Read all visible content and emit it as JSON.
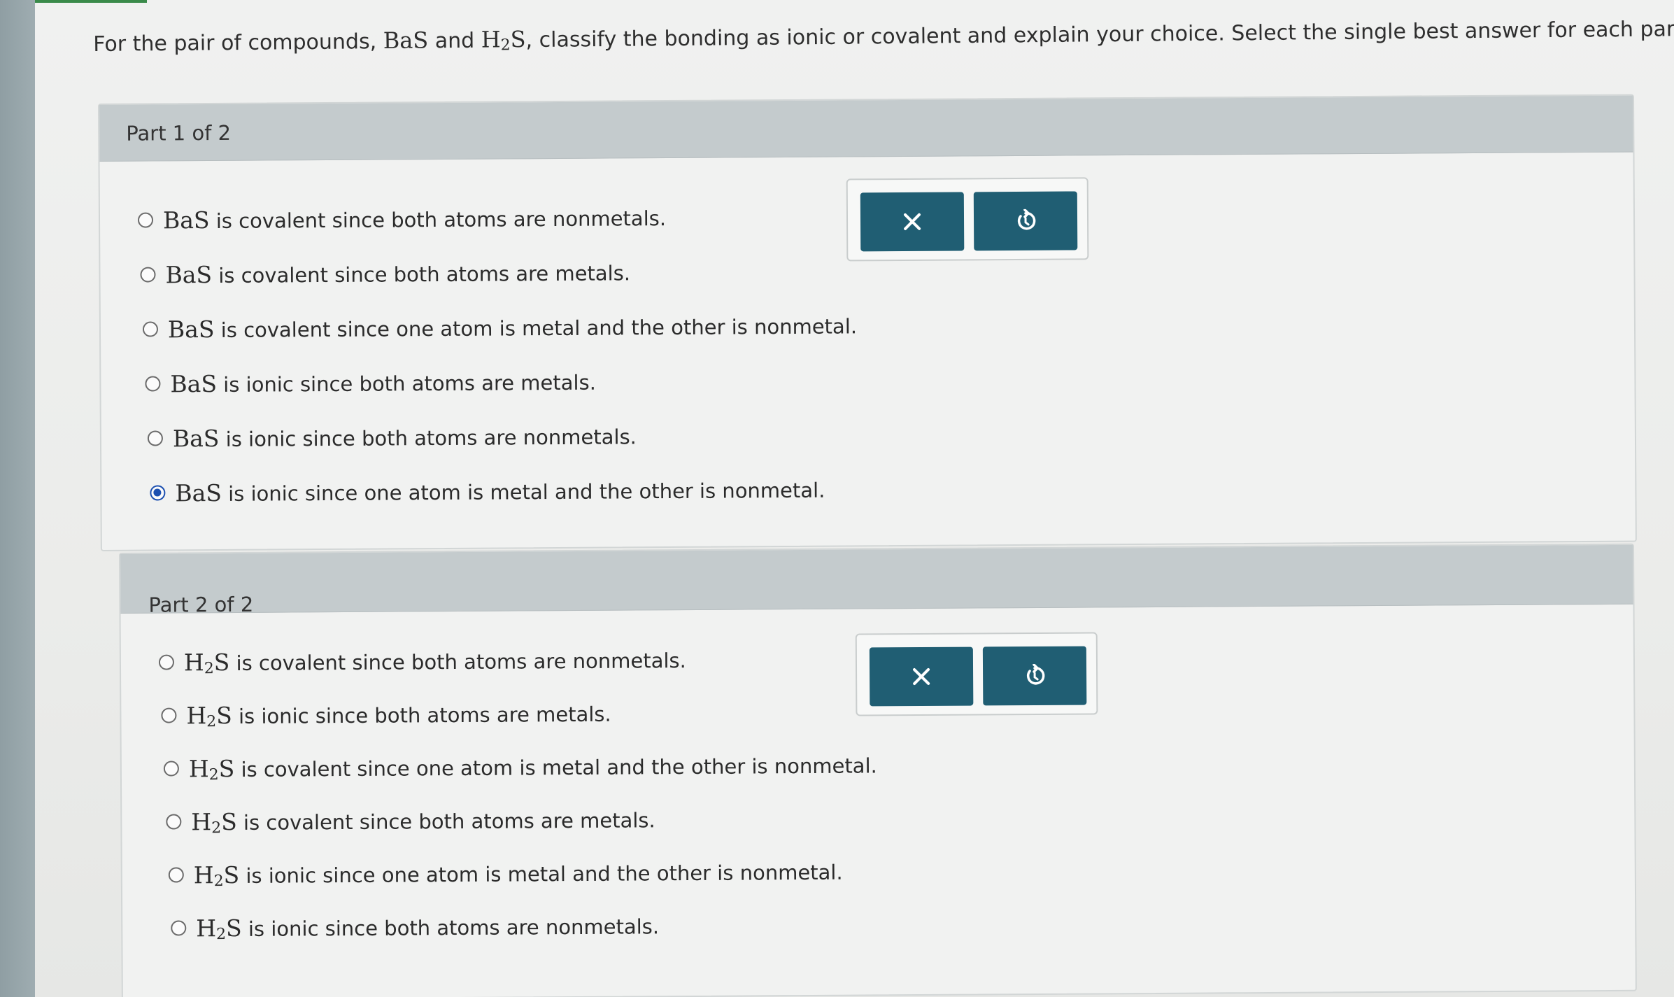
{
  "question": {
    "prefix": "For the pair of compounds, ",
    "compound_a": "BaS",
    "connector": " and ",
    "compound_b_main": "H",
    "compound_b_sub": "2",
    "compound_b_end": "S",
    "suffix": ", classify the bonding as ionic or covalent and explain your choice. Select the single best answer for each part."
  },
  "parts": [
    {
      "title": "Part 1 of 2",
      "options": [
        {
          "formula": "BaS",
          "text": " is covalent since both atoms are nonmetals.",
          "selected": false
        },
        {
          "formula": "BaS",
          "text": " is covalent since both atoms are metals.",
          "selected": false
        },
        {
          "formula": "BaS",
          "text": " is covalent since one atom is metal and the other is nonmetal.",
          "selected": false
        },
        {
          "formula": "BaS",
          "text": " is ionic since both atoms are metals.",
          "selected": false
        },
        {
          "formula": "BaS",
          "text": " is ionic since both atoms are nonmetals.",
          "selected": false
        },
        {
          "formula": "BaS",
          "text": " is ionic since one atom is metal and the other is nonmetal.",
          "selected": true
        }
      ],
      "buttons": {
        "clear_icon": "close-icon",
        "reset_icon": "undo-icon"
      }
    },
    {
      "title": "Part 2 of 2",
      "options": [
        {
          "formula_main": "H",
          "formula_sub": "2",
          "formula_end": "S",
          "text": " is covalent since both atoms are nonmetals.",
          "selected": false
        },
        {
          "formula_main": "H",
          "formula_sub": "2",
          "formula_end": "S",
          "text": " is ionic since both atoms are metals.",
          "selected": false
        },
        {
          "formula_main": "H",
          "formula_sub": "2",
          "formula_end": "S",
          "text": " is covalent since one atom is metal and the other is nonmetal.",
          "selected": false
        },
        {
          "formula_main": "H",
          "formula_sub": "2",
          "formula_end": "S",
          "text": " is covalent since both atoms are metals.",
          "selected": false
        },
        {
          "formula_main": "H",
          "formula_sub": "2",
          "formula_end": "S",
          "text": " is ionic since one atom is metal and the other is nonmetal.",
          "selected": false
        },
        {
          "formula_main": "H",
          "formula_sub": "2",
          "formula_end": "S",
          "text": " is ionic since both atoms are nonmetals.",
          "selected": false
        }
      ],
      "buttons": {
        "clear_icon": "close-icon",
        "reset_icon": "undo-icon"
      }
    }
  ],
  "colors": {
    "button_bg": "#205e73",
    "selected_radio": "#1b4fb0",
    "header_bg": "#c4cbcd"
  }
}
